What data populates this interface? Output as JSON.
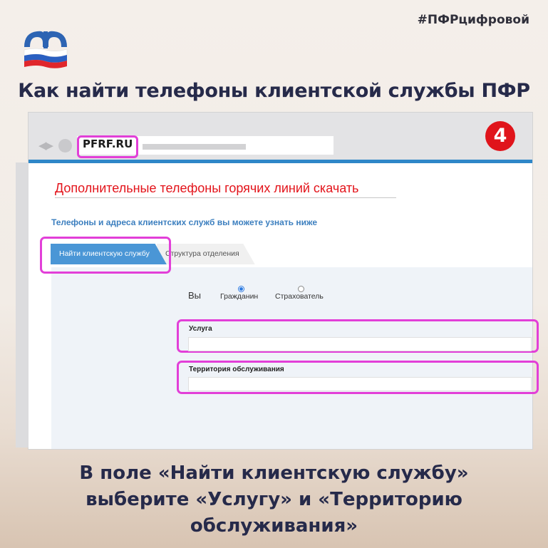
{
  "hashtag": "#ПФРцифровой",
  "headline": "Как найти телефоны клиентской службы ПФР",
  "browser": {
    "url": "PFRF.RU",
    "step_number": "4"
  },
  "page": {
    "download_link": "Дополнительные телефоны горячих линий скачать",
    "subtitle": "Телефоны и адреса клиентских служб вы можете узнать ниже",
    "tabs": [
      {
        "label": "Найти клиентскую службу",
        "active": true
      },
      {
        "label": "Структура отделения",
        "active": false
      }
    ],
    "radio_group": {
      "label": "Вы",
      "options": [
        {
          "label": "Гражданин",
          "checked": true
        },
        {
          "label": "Страхователь",
          "checked": false
        }
      ]
    },
    "fields": [
      {
        "label": "Услуга",
        "value": ""
      },
      {
        "label": "Территория обслуживания",
        "value": ""
      }
    ]
  },
  "instructions": [
    "В поле «Найти клиентскую службу»",
    "выберите «Услугу» и «Территорию",
    "обслуживания»"
  ],
  "colors": {
    "highlight": "#e23fd8",
    "accent_blue": "#4a96d6",
    "badge_red": "#e0141b",
    "text_dark": "#262a4a"
  }
}
